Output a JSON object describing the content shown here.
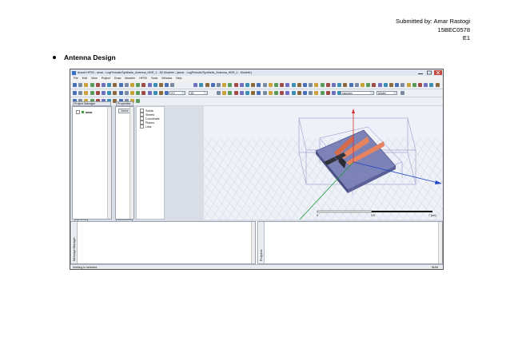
{
  "header": {
    "line1": "Submitted by: Amar Rastogi",
    "line2": "15BEC0578",
    "line3": "E1"
  },
  "section": {
    "bullet": "Antenna Design"
  },
  "screenshot": {
    "title": "Ansoft HFSS - amar - LogPeriodic/Synthetic_Antenna_HDR_1 - 3D Modeler - [amar - LogPeriodic/Synthetic_Antenna_HDR_1 - Modeler]",
    "menu": [
      "File",
      "Edit",
      "View",
      "Project",
      "Draw",
      "Modeler",
      "HFSS",
      "Tools",
      "Window",
      "Help"
    ],
    "toolbar": {
      "plane": "XY",
      "dim": "3D",
      "material": "vacuum",
      "mode": "Model"
    },
    "project_manager": {
      "title": "Project Manager",
      "item": "amar",
      "tab": "Project"
    },
    "properties": {
      "title": "Properties",
      "column": "Name",
      "tab": "Variables"
    },
    "tree": [
      "Solids",
      "Sheets",
      "Coordinate",
      "Planes",
      "Lists"
    ],
    "scale": {
      "left": "0",
      "mid": "3.5",
      "right": "7 (cm)"
    },
    "bottom": {
      "message_tab": "Message Manager",
      "progress_tab": "Progress"
    },
    "status": {
      "left": "Nothing is selected",
      "right": "NUM"
    },
    "colors": {
      "ground": "#9da3c8",
      "patch": "#e7835e",
      "axis_x": "#2346c8",
      "axis_z": "#d23030",
      "axis_y": "#1a9a3a"
    }
  }
}
